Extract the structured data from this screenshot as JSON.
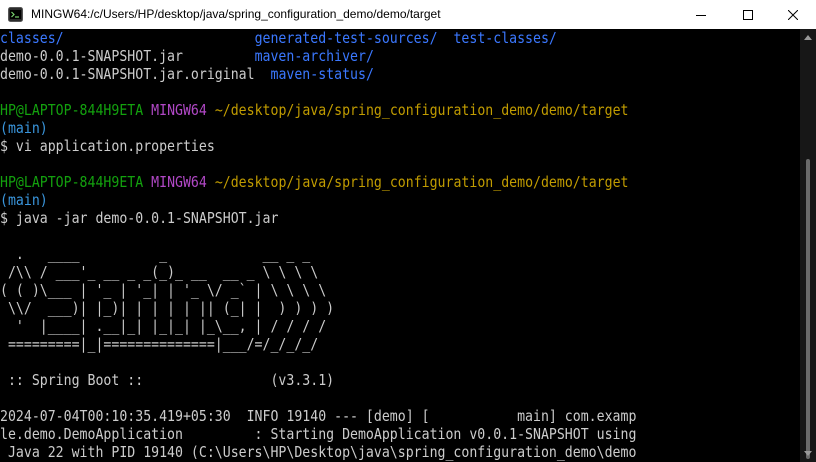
{
  "window": {
    "title": "MINGW64:/c/Users/HP/desktop/java/spring_configuration_demo/demo/target",
    "icon": "mingw-terminal-icon",
    "buttons": [
      "minimize-icon",
      "maximize-icon",
      "close-icon"
    ]
  },
  "colors": {
    "background": "#000000",
    "text": "#cccccc",
    "prompt_user": "#13a10e",
    "prompt_env": "#b148c6",
    "prompt_path": "#c19c00",
    "prompt_branch": "#3a96dd",
    "directory": "#3b78ff"
  },
  "terminal": {
    "listing": [
      [
        "classes/",
        "generated-test-sources/",
        "test-classes/"
      ],
      [
        "demo-0.0.1-SNAPSHOT.jar",
        "maven-archiver/",
        ""
      ],
      [
        "demo-0.0.1-SNAPSHOT.jar.original",
        "maven-status/",
        ""
      ]
    ],
    "prompt1": {
      "user": "HP@LAPTOP-844H9ETA",
      "env": "MINGW64",
      "path": "~/desktop/java/spring_configuration_demo/demo/target",
      "branch": "(main)",
      "command": "$ vi application.properties"
    },
    "prompt2": {
      "user": "HP@LAPTOP-844H9ETA",
      "env": "MINGW64",
      "path": "~/desktop/java/spring_configuration_demo/demo/target",
      "branch": "(main)",
      "command": "$ java -jar demo-0.0.1-SNAPSHOT.jar"
    },
    "banner": [
      "",
      "  .   ____          _            __ _ _",
      " /\\\\ / ___'_ __ _ _(_)_ __  __ _ \\ \\ \\ \\",
      "( ( )\\___ | '_ | '_| | '_ \\/ _` | \\ \\ \\ \\",
      " \\\\/  ___)| |_)| | | | | || (_| |  ) ) ) )",
      "  '  |____| .__|_| |_|_| |_\\__, | / / / /",
      " =========|_|==============|___/=/_/_/_/",
      ""
    ],
    "spring_boot_line": " :: Spring Boot ::                (v3.3.1)",
    "log_lines": [
      "2024-07-04T00:10:35.419+05:30  INFO 19140 --- [demo] [           main] com.examp",
      "le.demo.DemoApplication         : Starting DemoApplication v0.0.1-SNAPSHOT using",
      " Java 22 with PID 19140 (C:\\Users\\HP\\Desktop\\java\\spring_configuration_demo\\demo"
    ]
  }
}
